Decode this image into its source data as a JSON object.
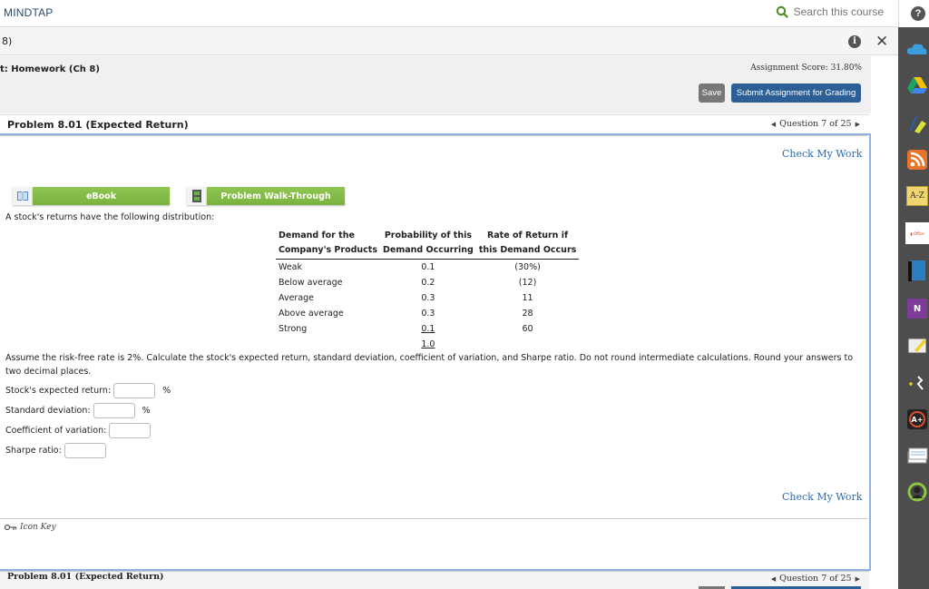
{
  "app": {
    "brand": "MINDTAP",
    "search_label": "Search this course",
    "help_label": "?"
  },
  "breadcrumb": {
    "title": "8)"
  },
  "assignment": {
    "title": "t: Homework (Ch 8)",
    "score_label": "Assignment Score: 31.80%",
    "save_label": "Save",
    "submit_label": "Submit Assignment for Grading"
  },
  "problem": {
    "title": "Problem 8.01 (Expected Return)",
    "question_nav": "Question 7 of 25",
    "check_my_work": "Check My Work",
    "ebook_label": "eBook",
    "walkthrough_label": "Problem Walk-Through",
    "intro": "A stock's returns have the following distribution:",
    "table": {
      "headers": [
        [
          "Demand for the",
          "Company's Products"
        ],
        [
          "Probability of this",
          "Demand Occurring"
        ],
        [
          "Rate of Return if",
          "this Demand Occurs"
        ]
      ],
      "rows": [
        {
          "demand": "Weak",
          "probability": "0.1",
          "return": "(30%)"
        },
        {
          "demand": "Below average",
          "probability": "0.2",
          "return": "(12)"
        },
        {
          "demand": "Average",
          "probability": "0.3",
          "return": "11"
        },
        {
          "demand": "Above average",
          "probability": "0.3",
          "return": "28"
        },
        {
          "demand": "Strong",
          "probability": "0.1",
          "return": "60"
        }
      ],
      "total_probability": "1.0"
    },
    "instructions": "Assume the risk-free rate is 2%. Calculate the stock's expected return, standard deviation, coefficient of variation, and Sharpe ratio. Do not round intermediate calculations. Round your answers to two decimal places.",
    "fields": [
      {
        "label": "Stock's expected return:",
        "value": "",
        "unit": "%"
      },
      {
        "label": "Standard deviation:",
        "value": "",
        "unit": "%"
      },
      {
        "label": "Coefficient of variation:",
        "value": "",
        "unit": ""
      },
      {
        "label": "Sharpe ratio:",
        "value": "",
        "unit": ""
      }
    ],
    "icon_key_label": "Icon Key"
  },
  "footer": {
    "title": "Problem 8.01 (Expected Return)",
    "question_nav": "Question 7 of 25"
  },
  "rail": {
    "items": [
      "onedrive-icon",
      "google-drive-icon",
      "highlighter-icon",
      "rss-icon",
      "glossary-az-icon",
      "office-icon",
      "book-icon",
      "onenote-icon",
      "notes-icon",
      "readspeaker-icon",
      "aplia-icon",
      "flashcards-icon",
      "progress-icon"
    ]
  },
  "colors": {
    "accent_blue": "#2c5f95",
    "link_blue": "#2c6bb0",
    "green_button": "#7ab340",
    "rail_bg": "#4d4d4d"
  }
}
